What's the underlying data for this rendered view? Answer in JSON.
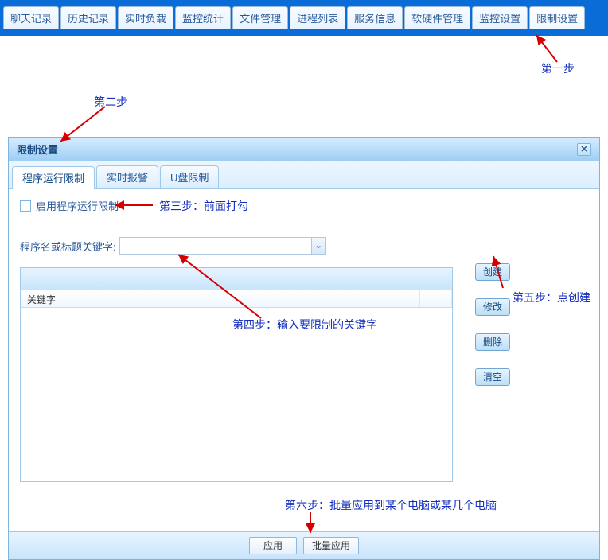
{
  "top_nav": {
    "tabs": [
      "聊天记录",
      "历史记录",
      "实时负载",
      "监控统计",
      "文件管理",
      "进程列表",
      "服务信息",
      "软硬件管理",
      "监控设置",
      "限制设置"
    ],
    "active_index": 9
  },
  "annotations": {
    "step1": "第一步",
    "step2": "第二步",
    "step3": "第三步：前面打勾",
    "step4": "第四步：输入要限制的关键字",
    "step5": "第五步：点创建",
    "step6": "第六步：批量应用到某个电脑或某几个电脑"
  },
  "dialog": {
    "title": "限制设置",
    "close": "✕",
    "sub_tabs": {
      "items": [
        "程序运行限制",
        "实时报警",
        "U盘限制"
      ],
      "active_index": 0
    },
    "checkbox_label": "启用程序运行限制",
    "keyword_label": "程序名或标题关键字:",
    "keyword_value": "",
    "grid": {
      "header": "关键字"
    },
    "buttons": {
      "create": "创建",
      "edit": "修改",
      "delete": "删除",
      "clear": "清空"
    },
    "bottom": {
      "apply": "应用",
      "batch_apply": "批量应用"
    }
  }
}
